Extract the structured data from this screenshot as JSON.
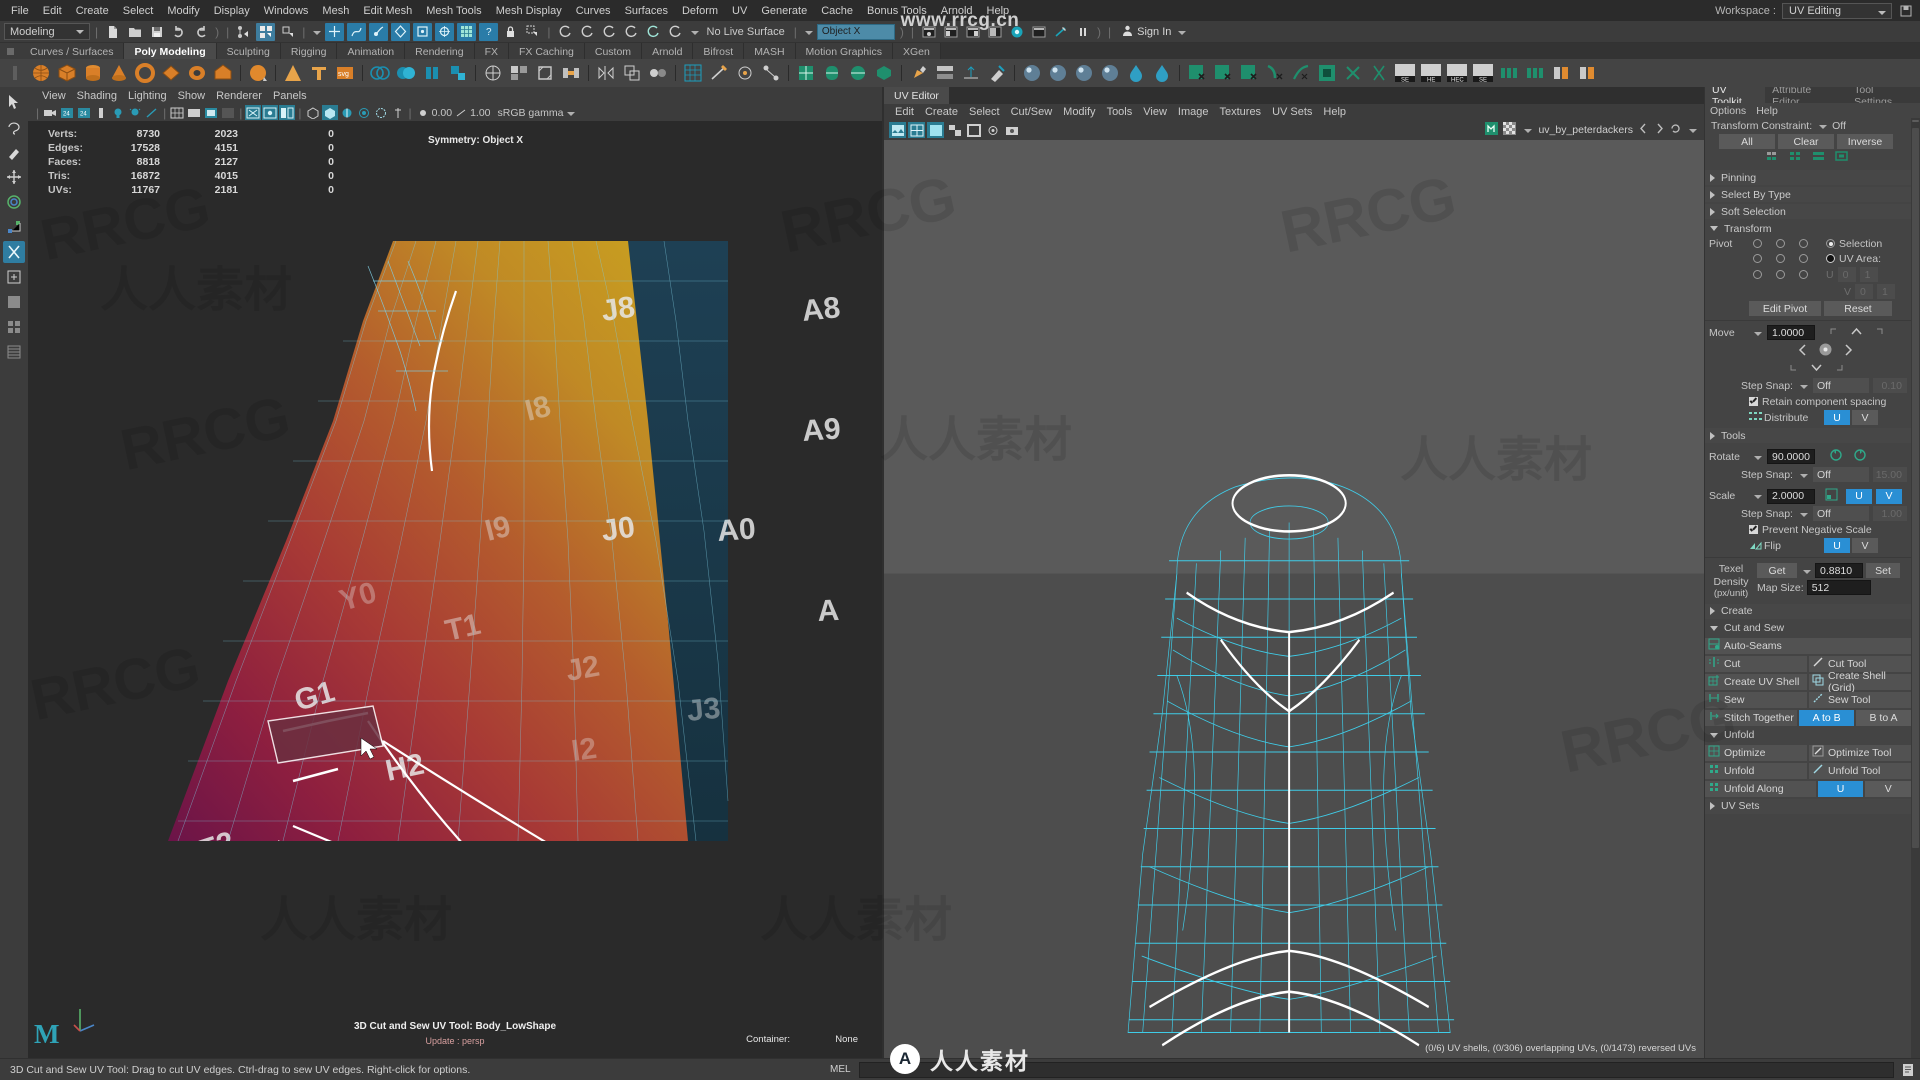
{
  "watermarks": {
    "top": "www.rrcg.cn",
    "bottom_text": "人人素材",
    "bottom_mark": "A",
    "tiles": [
      "RRCG",
      "人人素材"
    ]
  },
  "menubar": {
    "items": [
      "File",
      "Edit",
      "Create",
      "Select",
      "Modify",
      "Display",
      "Windows",
      "Mesh",
      "Edit Mesh",
      "Mesh Tools",
      "Mesh Display",
      "Curves",
      "Surfaces",
      "Deform",
      "UV",
      "Generate",
      "Cache",
      "Bonus Tools",
      "Arnold",
      "Help"
    ],
    "workspace_label": "Workspace :",
    "workspace_value": "UV Editing"
  },
  "statusline": {
    "mode": "Modeling",
    "no_live_surface": "No Live Surface",
    "object_field": "Object X",
    "sign_in": "Sign In",
    "icons": [
      "new-scene-icon",
      "open-scene-icon",
      "save-scene-icon",
      "undo-icon",
      "redo-icon",
      "select-by-hierarchy-icon",
      "select-by-object-icon",
      "select-by-component-icon",
      "snap-to-grid-icon",
      "snap-to-curve-icon",
      "snap-to-point-icon",
      "snap-to-projected-center-icon",
      "snap-to-view-plane-icon",
      "snap-to-pixel-icon",
      "make-live-icon",
      "lock-icon",
      "selection-mask-icon",
      "history-icon",
      "render-icon",
      "render-sequence-icon",
      "ipr-icon",
      "render-settings-icon",
      "hypershade-icon",
      "render-view-icon",
      "light-icon",
      "playblast-icon",
      "pause-icon"
    ]
  },
  "shelf": {
    "tabs": [
      "Curves / Surfaces",
      "Poly Modeling",
      "Sculpting",
      "Rigging",
      "Animation",
      "Rendering",
      "FX",
      "FX Caching",
      "Custom",
      "Arnold",
      "Bifrost",
      "MASH",
      "Motion Graphics",
      "XGen"
    ],
    "selected_tab": "Poly Modeling"
  },
  "viewport": {
    "panel_menu": [
      "View",
      "Shading",
      "Lighting",
      "Show",
      "Renderer",
      "Panels"
    ],
    "hud": {
      "rows": [
        {
          "label": "Verts:",
          "c1": "8730",
          "c2": "2023",
          "c3": "0"
        },
        {
          "label": "Edges:",
          "c1": "17528",
          "c2": "4151",
          "c3": "0"
        },
        {
          "label": "Faces:",
          "c1": "8818",
          "c2": "2127",
          "c3": "0"
        },
        {
          "label": "Tris:",
          "c1": "16872",
          "c2": "4015",
          "c3": "0"
        },
        {
          "label": "UVs:",
          "c1": "11767",
          "c2": "2181",
          "c3": "0"
        }
      ]
    },
    "symmetry_label": "Symmetry: Object X",
    "tool_status": "3D Cut and Sew UV Tool: Body_LowShape",
    "tool_status2": "Update : persp",
    "container_label": "Container:",
    "container_value": "None",
    "exposure": "0.00",
    "gamma": "1.00",
    "color_space": "sRGB gamma",
    "axis": {
      "x": "x",
      "y": "y",
      "z": "z"
    },
    "logo": "M"
  },
  "uv_editor": {
    "title": "UV Editor",
    "menu": [
      "Edit",
      "Create",
      "Select",
      "Cut/Sew",
      "Modify",
      "Tools",
      "View",
      "Image",
      "Textures",
      "UV Sets",
      "Help"
    ],
    "texture_name": "uv_by_peterdackers",
    "status": "(0/6) UV shells, (0/306) overlapping UVs, (0/1473) reversed UVs"
  },
  "uv_toolkit": {
    "tabs": [
      "UV Toolkit",
      "Attribute Editor",
      "Tool Settings"
    ],
    "selected_tab": "UV Toolkit",
    "menu": [
      "Options",
      "Help"
    ],
    "transform_constraint_label": "Transform Constraint:",
    "transform_constraint_value": "Off",
    "selection_buttons": [
      "All",
      "Clear",
      "Inverse"
    ],
    "component_icons": [
      "uv-component-icon",
      "vertex-component-icon",
      "edge-component-icon",
      "face-component-icon"
    ],
    "sections": [
      {
        "label": "Pinning",
        "expanded": false
      },
      {
        "label": "Select By Type",
        "expanded": false
      },
      {
        "label": "Soft Selection",
        "expanded": false
      },
      {
        "label": "Transform",
        "expanded": true
      }
    ],
    "transform": {
      "pivot_label": "Pivot",
      "selection_label": "Selection",
      "uv_area_label": "UV Area:",
      "u_label": "U",
      "v_label": "V",
      "u_min": "0",
      "u_max": "1",
      "v_min": "0",
      "v_max": "1",
      "edit_pivot": "Edit Pivot",
      "reset": "Reset",
      "move_label": "Move",
      "move_value": "1.0000",
      "move_step_snap_label": "Step Snap:",
      "move_step_snap_value": "Off",
      "move_step_snap_num": "0.10",
      "retain_spacing": "Retain component spacing",
      "distribute_label": "Distribute",
      "distribute_u": "U",
      "distribute_v": "V",
      "tools_label": "Tools",
      "rotate_label": "Rotate",
      "rotate_value": "90.0000",
      "rotate_step_snap_label": "Step Snap:",
      "rotate_step_snap_value": "Off",
      "rotate_step_snap_num": "15.00",
      "scale_label": "Scale",
      "scale_value": "2.0000",
      "scale_u": "U",
      "scale_v": "V",
      "scale_step_snap_label": "Step Snap:",
      "scale_step_snap_value": "Off",
      "scale_step_snap_num": "1.00",
      "prevent_negative_scale": "Prevent Negative Scale",
      "flip_label": "Flip",
      "flip_u": "U",
      "flip_v": "V"
    },
    "texel": {
      "label_line1": "Texel",
      "label_line2": "Density",
      "label_line3": "(px/unit)",
      "get": "Get",
      "value": "0.8810",
      "set": "Set",
      "map_size_label": "Map Size:",
      "map_size_value": "512"
    },
    "create_label": "Create",
    "cut_and_sew_label": "Cut and Sew",
    "cut_sew_buttons": [
      {
        "left": "Auto-Seams",
        "right": ""
      },
      {
        "left": "Cut",
        "right": "Cut Tool"
      },
      {
        "left": "Create UV Shell",
        "right": "Create Shell (Grid)"
      },
      {
        "left": "Sew",
        "right": "Sew Tool"
      },
      {
        "left": "Stitch Together",
        "right": "A to B",
        "right2": "B to A"
      }
    ],
    "unfold_label": "Unfold",
    "unfold_buttons": [
      {
        "left": "Optimize",
        "right": "Optimize Tool"
      },
      {
        "left": "Unfold",
        "right": "Unfold Tool"
      },
      {
        "left": "Unfold Along",
        "u": "U",
        "v": "V"
      }
    ],
    "uv_sets_label": "UV Sets"
  },
  "statusbar": {
    "help": "3D Cut and Sew UV Tool: Drag to cut UV edges. Ctrl-drag to sew UV edges. Right-click for options.",
    "mel_label": "MEL",
    "command_value": ""
  },
  "colors": {
    "accent_blue": "#2a8fd4",
    "teal": "#2a7c92",
    "green": "#1f8f6d",
    "orange": "#d4832a",
    "panel_bg": "#444444",
    "dark_bg": "#2b2b2b",
    "uv_wire": "#3fd3f0"
  }
}
